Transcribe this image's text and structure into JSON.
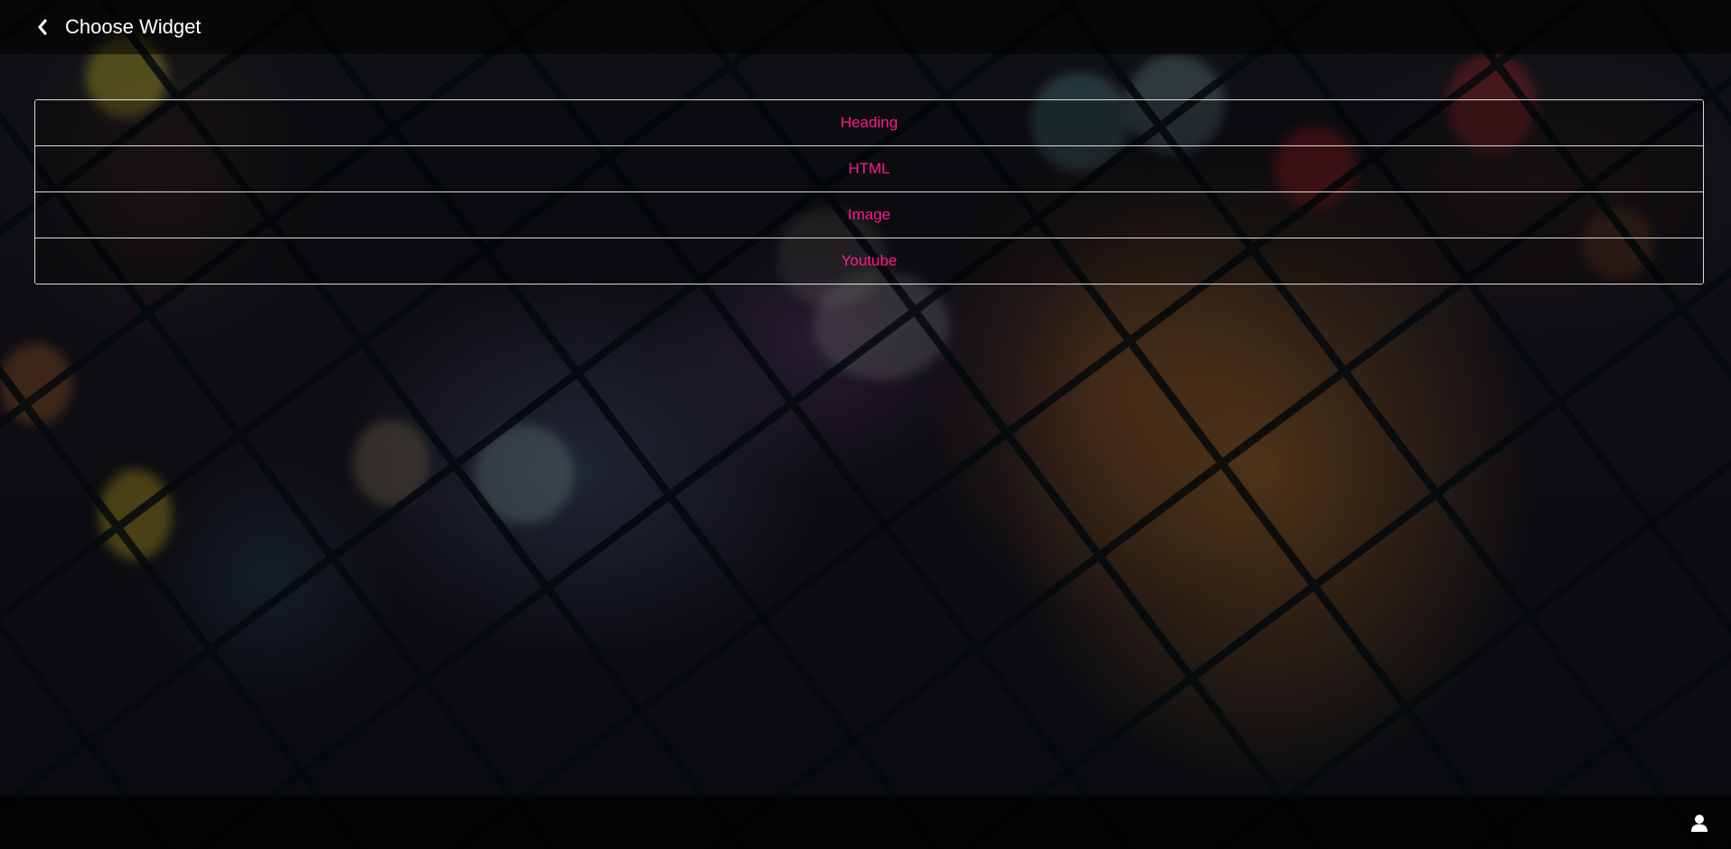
{
  "header": {
    "title": "Choose Widget",
    "back_icon": "chevron-left-icon"
  },
  "widgets": {
    "items": [
      {
        "label": "Heading"
      },
      {
        "label": "HTML"
      },
      {
        "label": "Image"
      },
      {
        "label": "Youtube"
      }
    ],
    "label_color": "#ff1a8c"
  },
  "footer": {
    "user_icon": "user-icon"
  }
}
